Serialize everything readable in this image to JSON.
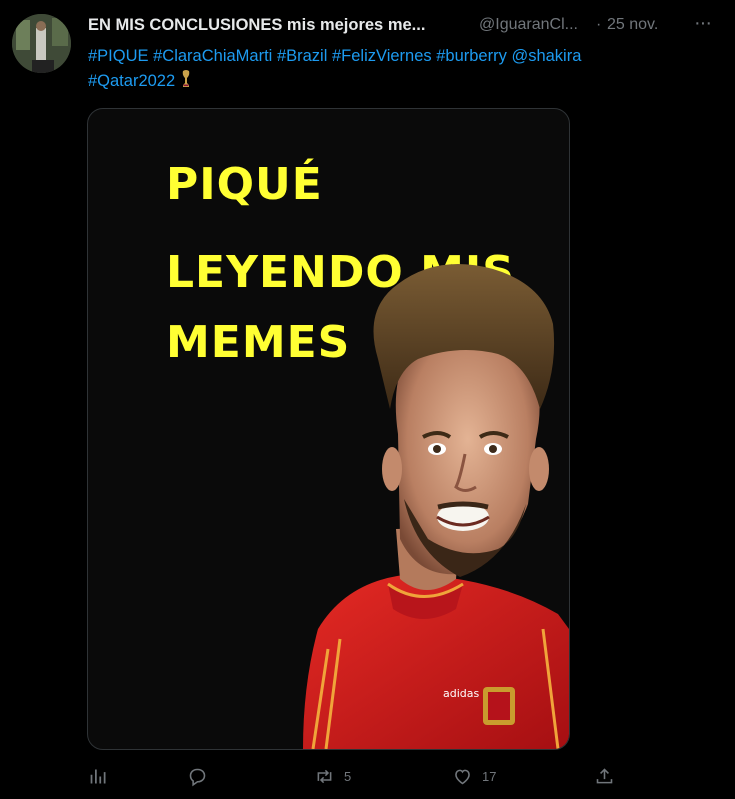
{
  "tweet": {
    "display_name": "EN MIS CONCLUSIONES mis mejores me...",
    "handle": "@IguaranCl...",
    "separator": "·",
    "date": "25 nov.",
    "more_label": "···",
    "hashtags_line1": [
      "#PIQUE",
      "#ClaraChiaMarti",
      "#Brazil",
      "#FelizViernes",
      "#burberry",
      "@shakira"
    ],
    "hashtags_line2": [
      "#Qatar2022"
    ]
  },
  "media": {
    "meme_line1": "PIQUÉ",
    "meme_line2": "LEYENDO MIS",
    "meme_line3": "MEMES",
    "jersey_brand": "adidas"
  },
  "actions": {
    "views_icon": "analytics-icon",
    "reply_icon": "reply-icon",
    "reply_count": "",
    "retweet_icon": "retweet-icon",
    "retweet_count": "5",
    "like_icon": "heart-icon",
    "like_count": "17",
    "share_icon": "share-icon"
  },
  "colors": {
    "background": "#000000",
    "text": "#e7e9ea",
    "muted": "#71767b",
    "link": "#1d9bf0",
    "meme_text": "#ffff33",
    "jersey": "#d41b1b"
  }
}
